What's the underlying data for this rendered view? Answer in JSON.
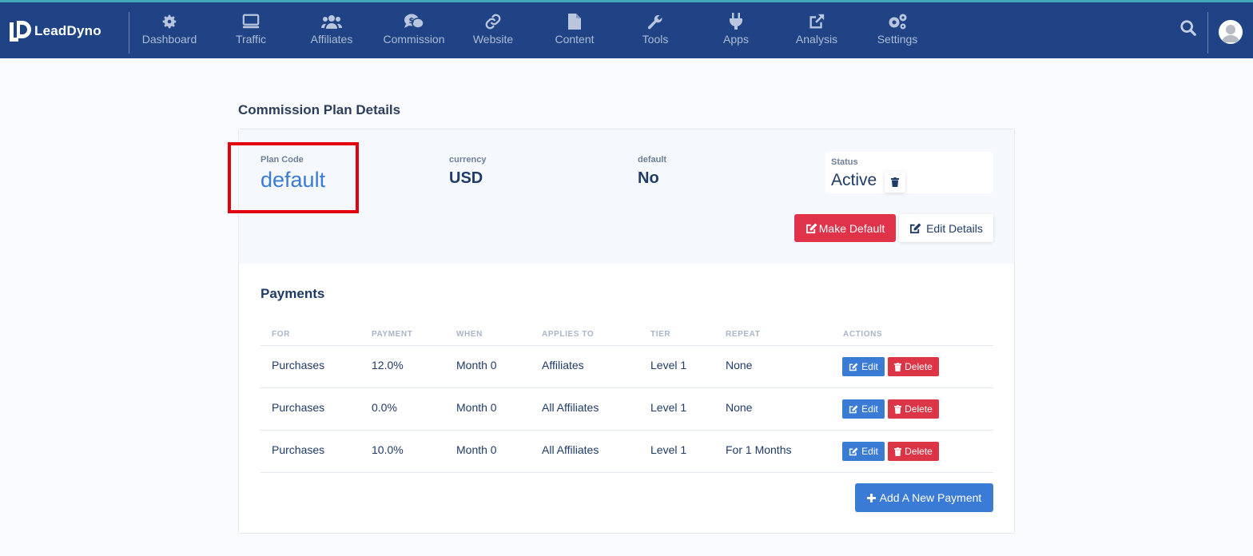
{
  "brand": {
    "name": "LeadDyno"
  },
  "nav": {
    "items": [
      {
        "label": "Dashboard",
        "icon": "gear-icon"
      },
      {
        "label": "Traffic",
        "icon": "monitor-icon"
      },
      {
        "label": "Affiliates",
        "icon": "users-icon"
      },
      {
        "label": "Commission",
        "icon": "money-chat-icon"
      },
      {
        "label": "Website",
        "icon": "link-icon"
      },
      {
        "label": "Content",
        "icon": "file-icon"
      },
      {
        "label": "Tools",
        "icon": "wrench-icon"
      },
      {
        "label": "Apps",
        "icon": "plug-icon"
      },
      {
        "label": "Analysis",
        "icon": "external-link-icon"
      },
      {
        "label": "Settings",
        "icon": "gears-icon"
      }
    ]
  },
  "page": {
    "title": "Commission Plan Details"
  },
  "plan": {
    "plan_code_label": "Plan Code",
    "plan_code": "default",
    "currency_label": "currency",
    "currency": "USD",
    "default_label": "default",
    "default": "No",
    "status_label": "Status",
    "status": "Active",
    "make_default_label": "Make Default",
    "edit_details_label": "Edit Details"
  },
  "payments": {
    "title": "Payments",
    "columns": [
      "FOR",
      "PAYMENT",
      "WHEN",
      "APPLIES TO",
      "TIER",
      "REPEAT",
      "ACTIONS"
    ],
    "rows": [
      {
        "for": "Purchases",
        "payment": "12.0%",
        "when": "Month 0",
        "applies_to": "Affiliates",
        "tier": "Level 1",
        "repeat": "None"
      },
      {
        "for": "Purchases",
        "payment": "0.0%",
        "when": "Month 0",
        "applies_to": "All Affiliates",
        "tier": "Level 1",
        "repeat": "None"
      },
      {
        "for": "Purchases",
        "payment": "10.0%",
        "when": "Month 0",
        "applies_to": "All Affiliates",
        "tier": "Level 1",
        "repeat": "For 1 Months"
      }
    ],
    "edit_label": "Edit",
    "delete_label": "Delete",
    "add_label": "Add A New Payment"
  },
  "colors": {
    "nav_bg": "#1f4385",
    "accent_blue": "#3a7bd5",
    "danger": "#dc3545",
    "highlight": "#e3000f"
  }
}
